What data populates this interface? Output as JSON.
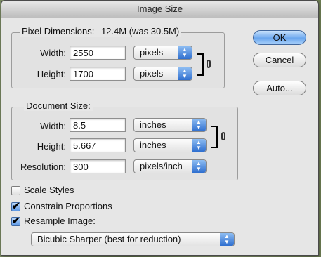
{
  "dialog": {
    "title": "Image Size"
  },
  "pixel_dimensions": {
    "legend": "Pixel Dimensions:",
    "size": "12.4M (was 30.5M)",
    "width_label": "Width:",
    "width_value": "2550",
    "width_unit": "pixels",
    "height_label": "Height:",
    "height_value": "1700",
    "height_unit": "pixels"
  },
  "document_size": {
    "legend": "Document Size:",
    "width_label": "Width:",
    "width_value": "8.5",
    "width_unit": "inches",
    "height_label": "Height:",
    "height_value": "5.667",
    "height_unit": "inches",
    "resolution_label": "Resolution:",
    "resolution_value": "300",
    "resolution_unit": "pixels/inch"
  },
  "buttons": {
    "ok": "OK",
    "cancel": "Cancel",
    "auto": "Auto..."
  },
  "options": {
    "scale_styles": {
      "label": "Scale Styles",
      "checked": false
    },
    "constrain_proportions": {
      "label": "Constrain Proportions",
      "checked": true
    },
    "resample_image": {
      "label": "Resample Image:",
      "checked": true
    },
    "resample_method": "Bicubic Sharper (best for reduction)"
  },
  "icons": {
    "popup": "updown-arrows-icon",
    "link": "chain-link-icon",
    "check": "checkmark-icon"
  },
  "colors": {
    "accent": "#5c98e6",
    "window": "#e6e6e6"
  }
}
